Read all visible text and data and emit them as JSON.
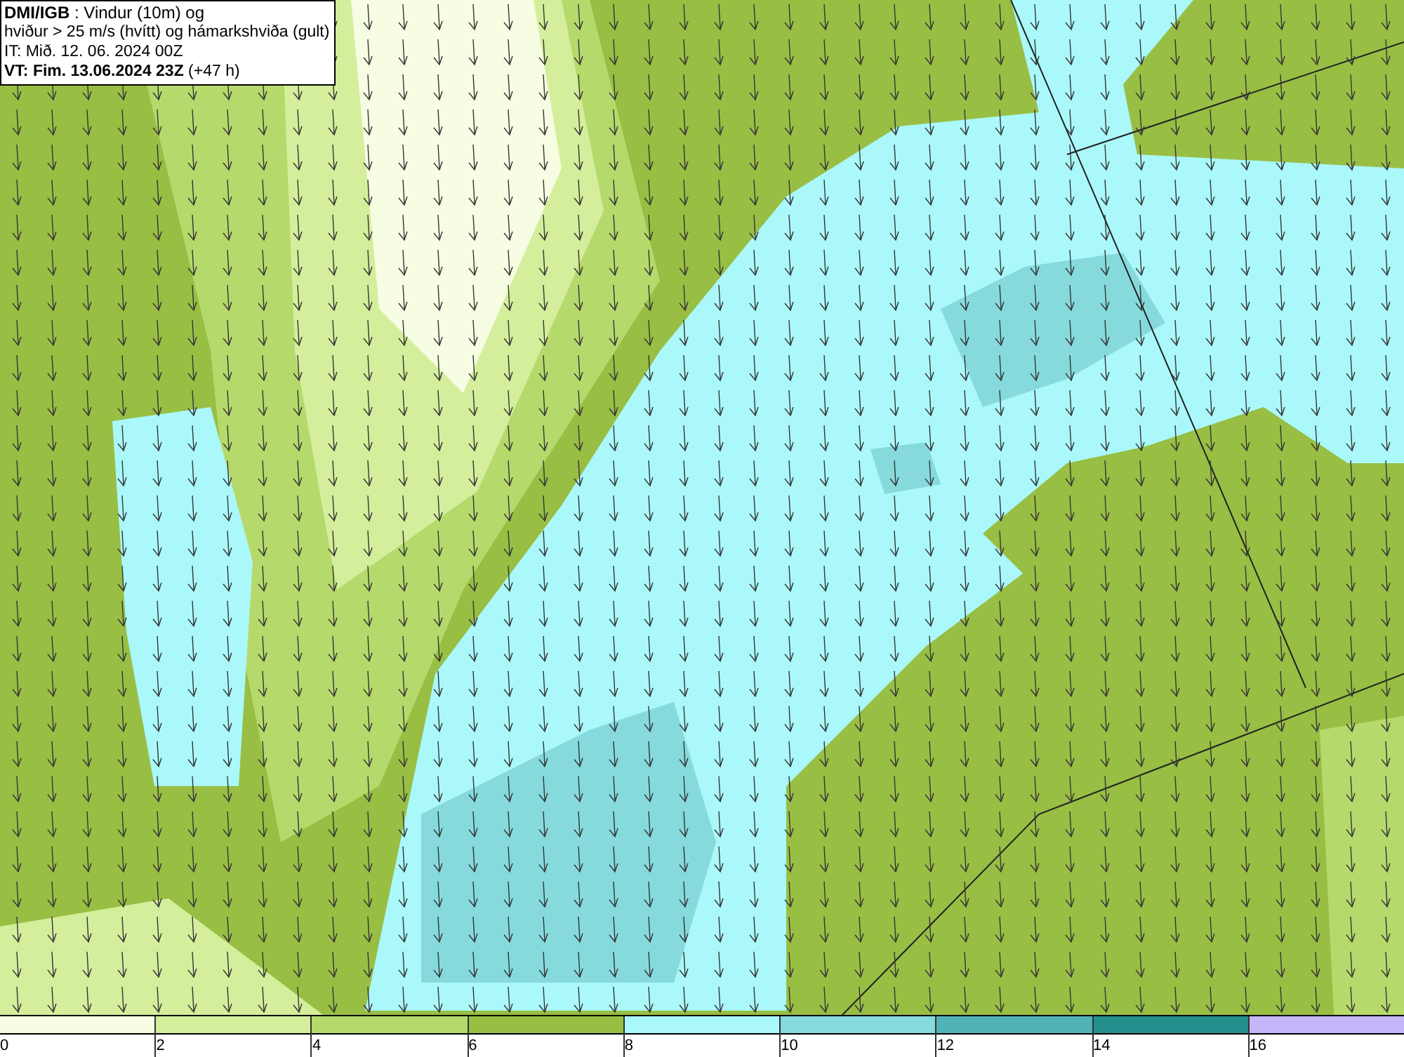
{
  "header": {
    "lines": [
      "**DMI/IGB** : Vindur (10m) og",
      "hviður > 25 m/s (hvítt) og hámarkshviða (gult)",
      "IT: Mið. 12. 06. 2024 00Z",
      "**VT: Fim. 13.06.2024 23Z** (+47 h)"
    ]
  },
  "legend": {
    "bins": [
      {
        "label": "0",
        "color": "#f6fde2"
      },
      {
        "label": "2",
        "color": "#d4ee9c"
      },
      {
        "label": "4",
        "color": "#b6d96c"
      },
      {
        "label": "6",
        "color": "#98be44"
      },
      {
        "label": "8",
        "color": "#aaf8fa"
      },
      {
        "label": "10",
        "color": "#86dadc"
      },
      {
        "label": "12",
        "color": "#52b3b6"
      },
      {
        "label": "14",
        "color": "#23908e"
      },
      {
        "label": "16",
        "color": "#c4b4f8"
      }
    ]
  }
}
